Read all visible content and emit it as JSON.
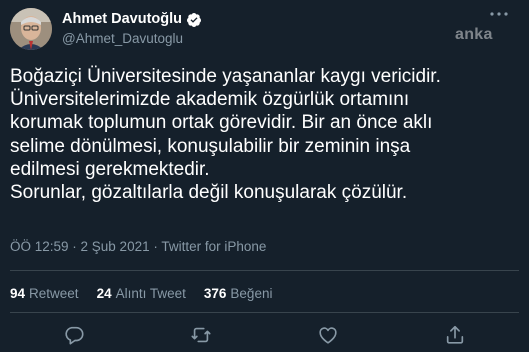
{
  "user": {
    "display_name": "Ahmet Davutoğlu",
    "handle": "@Ahmet_Davutoglu",
    "verified": true
  },
  "watermark": "anka",
  "tweet": {
    "lines": [
      "Boğaziçi Üniversitesinde yaşananlar kaygı vericidir.",
      "Üniversitelerimizde akademik özgürlük ortamını",
      "korumak toplumun ortak görevidir. Bir an önce aklı",
      "selime dönülmesi, konuşulabilir bir zeminin inşa",
      "edilmesi gerekmektedir.",
      "Sorunlar, gözaltılarla değil konuşularak çözülür."
    ],
    "timestamp": "ÖÖ 12:59 · 2 Şub 2021 ·",
    "source": "Twitter for iPhone"
  },
  "stats": {
    "retweets_count": "94",
    "retweets_label": "Retweet",
    "quotes_count": "24",
    "quotes_label": "Alıntı Tweet",
    "likes_count": "376",
    "likes_label": "Beğeni"
  },
  "icons": {
    "reply": "reply-icon",
    "retweet": "retweet-icon",
    "like": "heart-icon",
    "share": "share-icon",
    "more": "more-icon",
    "verified": "verified-badge-icon"
  },
  "colors": {
    "background": "#15202b",
    "secondary_text": "#8899a6",
    "verified_fill": "#ffffff",
    "divider": "#38444d"
  }
}
